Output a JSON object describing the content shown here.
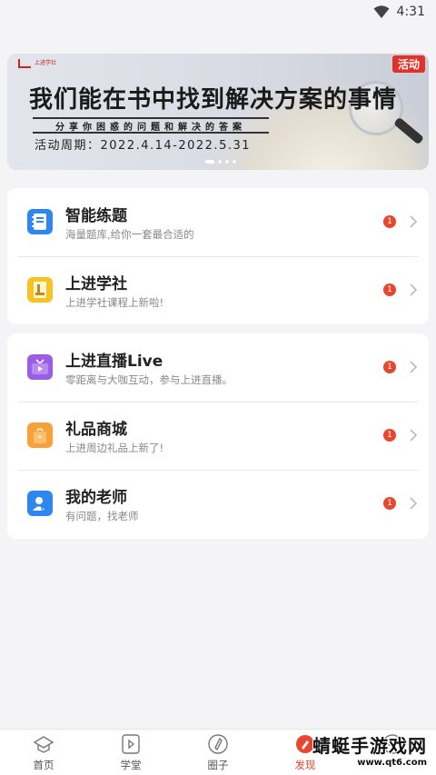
{
  "status_bar": {
    "time": "4:31"
  },
  "banner": {
    "tag": "活动",
    "logo_text": "上进学社",
    "headline": "我们能在书中找到解决方案的事情",
    "subline": "分享你困惑的问题和解决的答案",
    "period": "活动周期：2022.4.14-2022.5.31",
    "slides_total": 4,
    "slide_active": 1
  },
  "section1": {
    "items": [
      {
        "title": "智能练题",
        "desc": "海量题库,给你一套最合适的",
        "badge": "1",
        "icon": "notebook-icon",
        "color": "#2e86f0"
      },
      {
        "title": "上进学社",
        "desc": "上进学社课程上新啦!",
        "badge": "1",
        "icon": "book-icon",
        "color": "#f5c423"
      }
    ]
  },
  "section2": {
    "items": [
      {
        "title": "上进直播Live",
        "desc": "零距离与大咖互动，参与上进直播。",
        "badge": "1",
        "icon": "tv-icon",
        "color": "#9b5de5"
      },
      {
        "title": "礼品商城",
        "desc": "上进周边礼品上新了!",
        "badge": "1",
        "icon": "gift-bag-icon",
        "color": "#f7a13a"
      },
      {
        "title": "我的老师",
        "desc": "有问题，找老师",
        "badge": "1",
        "icon": "teacher-icon",
        "color": "#2e86f0"
      }
    ]
  },
  "tabbar": {
    "tabs": [
      {
        "label": "首页",
        "icon": "home-icon"
      },
      {
        "label": "学堂",
        "icon": "play-icon"
      },
      {
        "label": "圈子",
        "icon": "compass-icon"
      },
      {
        "label": "发现",
        "icon": "discover-icon",
        "active": true
      },
      {
        "label": "",
        "icon": "profile-icon"
      }
    ]
  },
  "watermark": {
    "title": "蜻蜓手游戏网",
    "url": "www.qt6.com"
  },
  "colors": {
    "accent": "#e8472f",
    "background": "#f4f4f6"
  }
}
